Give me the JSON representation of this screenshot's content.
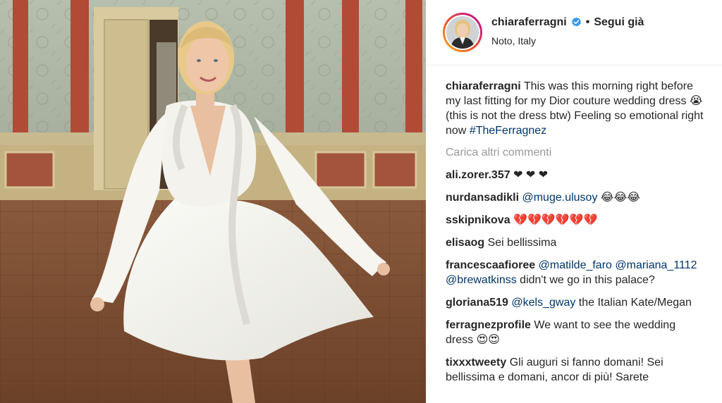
{
  "post": {
    "username": "chiaraferragni",
    "follow_label": "Segui già",
    "separator": "•",
    "location": "Noto, Italy",
    "verified_icon": "verified-badge-icon",
    "accent_color": "#3897f0"
  },
  "caption": {
    "username": "chiaraferragni",
    "text": "This was this morning right before my last fitting for my Dior couture wedding dress 😭 (this is not the dress btw) Feeling so emotional right now",
    "hashtag": "#TheFerragnez"
  },
  "load_more_label": "Carica altri commenti",
  "comments": [
    {
      "username": "ali.zorer.357",
      "pre": "",
      "mention": "",
      "text": "❤ ❤ ❤"
    },
    {
      "username": "nurdansadikli",
      "pre": "",
      "mention": "@muge.ulusoy",
      "text": "😂😂😂"
    },
    {
      "username": "sskipnikova",
      "pre": "",
      "mention": "",
      "text": "💔💔💔💔💔💔"
    },
    {
      "username": "elisaog",
      "pre": "",
      "mention": "",
      "text": "Sei bellissima"
    },
    {
      "username": "francescaafioree",
      "mention": "@matilde_faro",
      "mention2": "@mariana_1112",
      "mention3": "@brewatkinss",
      "text": "didn't we go in this palace?"
    },
    {
      "username": "gloriana519",
      "mention": "@kels_gway",
      "text": "the Italian Kate/Megan"
    },
    {
      "username": "ferragnezprofile",
      "mention": "",
      "text": "We want to see the wedding dress 😍😍"
    },
    {
      "username": "tixxxtweety",
      "mention": "",
      "text": "Gli auguri si fanno domani! Sei bellissima e domani, ancor di più! Sarete"
    }
  ]
}
